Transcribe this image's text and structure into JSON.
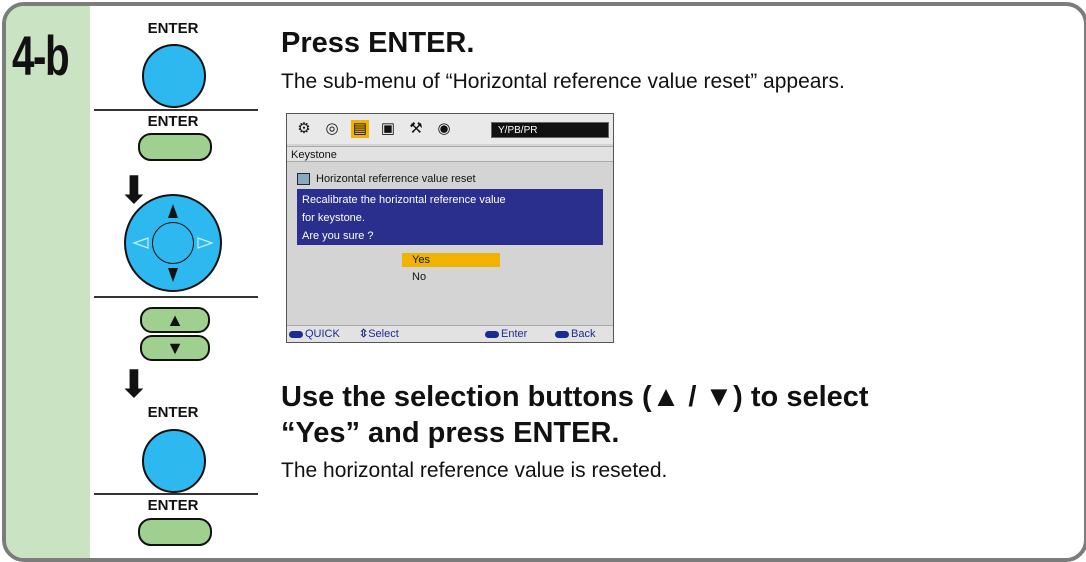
{
  "step": {
    "label": "4-b"
  },
  "buttons": {
    "enter_label": "ENTER",
    "up_arrow": "▲",
    "down_arrow": "▼",
    "down_step_arrow": "⬇"
  },
  "section1": {
    "heading": "Press ENTER.",
    "body": "The sub-menu of “Horizontal reference value reset” appears."
  },
  "osd": {
    "source": "Y/PB/PR",
    "menu_title": "Keystone",
    "submenu_title": "Horizontal referrence value reset",
    "message_lines": [
      "Recalibrate the horizontal reference value",
      "for keystone.",
      "Are you sure ?"
    ],
    "options": {
      "yes": "Yes",
      "no": "No"
    },
    "footer": {
      "quick": "QUICK",
      "select": "Select",
      "enter": "Enter",
      "back": "Back"
    },
    "icons": [
      "projector-icon",
      "picture-icon",
      "setup-icon",
      "display-icon",
      "tools-icon",
      "signal-icon"
    ]
  },
  "section2": {
    "heading_line1": "Use the selection buttons (▲ / ▼) to select",
    "heading_line2": "“Yes” and press ENTER.",
    "body": "The horizontal reference value is reseted."
  },
  "colors": {
    "accent_blue": "#2eb8f0",
    "pill_green": "#9fd08f",
    "step_green": "#c9e3c3",
    "frame_gray": "#7c7c7c",
    "osd_highlight": "#f0b400",
    "osd_msg_bg": "#2a2f8e"
  }
}
